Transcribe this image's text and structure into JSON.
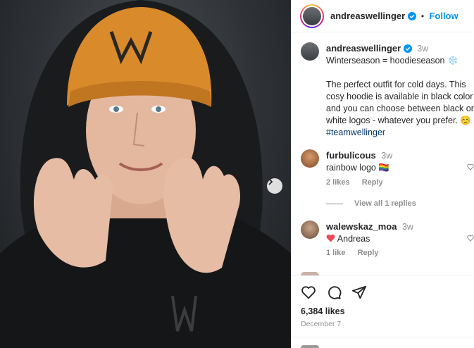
{
  "post": {
    "username": "andreaswellinger",
    "follow_label": "Follow",
    "dot": "•",
    "caption_time": "3w",
    "caption_line1": "Winterseason = hoodieseason ❄️",
    "caption_line2": "The perfect outfit for cold days. This cosy hoodie is available in black color and you can choose between black or white logos - whatever you prefer. ☺️",
    "hashtag": "#teamwellinger",
    "likes": "6,384 likes",
    "date": "December 7"
  },
  "comments": [
    {
      "username": "furbulicous",
      "time": "3w",
      "text": "rainbow logo 🏳️‍🌈",
      "likes": "2 likes",
      "reply": "Reply",
      "view_replies": "View all 1 replies"
    },
    {
      "username": "walewskaz_moa",
      "time": "3w",
      "text": "Andreas",
      "likes": "1 like",
      "reply": "Reply"
    }
  ],
  "icons": {
    "next": "chevron-right-icon",
    "like": "heart-icon",
    "comment": "comment-icon",
    "share": "paper-plane-icon",
    "verified": "verified-badge-icon"
  },
  "colors": {
    "link_blue": "#0095f6",
    "hashtag": "#00376b",
    "beanie": "#d98a2b",
    "heart_red": "#ed4956"
  }
}
